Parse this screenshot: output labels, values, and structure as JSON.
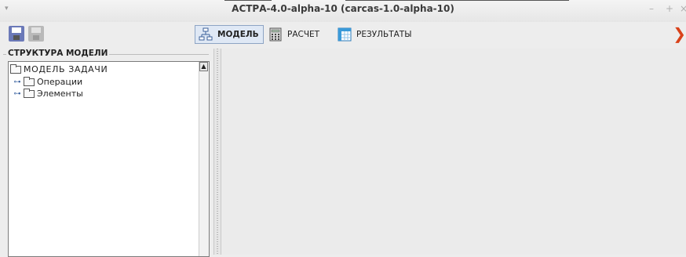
{
  "window": {
    "title": "АСТРА-4.0-alpha-10 (carcas-1.0-alpha-10)",
    "menu_glyph": "▾",
    "minimize_glyph": "–",
    "maximize_glyph": "+",
    "close_glyph": "×"
  },
  "toolbar": {
    "save_icon": "floppy-disk-icon",
    "save_disabled_icon": "floppy-disk-disabled-icon",
    "tabs": [
      {
        "label": "МОДЕЛЬ",
        "icon": "model-tree-icon",
        "active": true
      },
      {
        "label": "РАСЧЕТ",
        "icon": "calculator-icon",
        "active": false
      },
      {
        "label": "РЕЗУЛЬТАТЫ",
        "icon": "results-table-icon",
        "active": false
      }
    ],
    "exit_glyph": "❯"
  },
  "left_panel": {
    "group_title": "СТРУКТУРА МОДЕЛИ",
    "tree": {
      "root": "МОДЕЛЬ ЗАДАЧИ",
      "children": [
        "Операции",
        "Элементы"
      ],
      "expander_glyph": "⊶"
    },
    "scroll_up_glyph": "▲"
  },
  "colors": {
    "accent_active_tab": "#dfe8f5",
    "close_red": "#d9421a"
  }
}
